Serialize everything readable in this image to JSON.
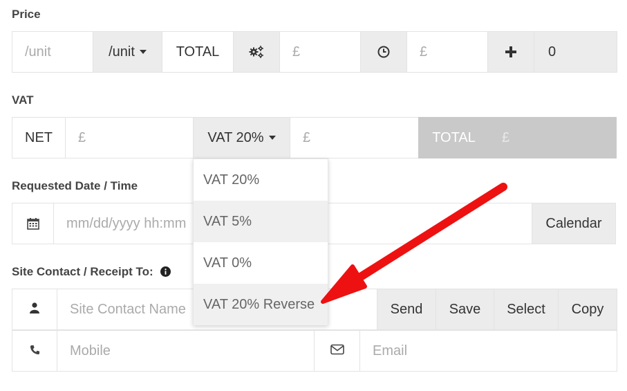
{
  "price": {
    "label": "Price",
    "unit_placeholder": "/unit",
    "unit_dropdown": "/unit",
    "total_label": "TOTAL",
    "total_placeholder": "£",
    "clock_placeholder": "£",
    "quantity_value": "0"
  },
  "vat": {
    "label": "VAT",
    "net_label": "NET",
    "net_placeholder": "£",
    "rate_dropdown": "VAT 20%",
    "vat_placeholder": "£",
    "total_label": "TOTAL",
    "total_placeholder": "£",
    "options": [
      "VAT 20%",
      "VAT 5%",
      "VAT 0%",
      "VAT 20% Reverse"
    ]
  },
  "date": {
    "label": "Requested Date / Time",
    "placeholder": "mm/dd/yyyy hh:mm",
    "calendar_button": "Calendar"
  },
  "site_contact": {
    "label": "Site Contact / Receipt To:",
    "name_placeholder": "Site Contact Name",
    "send_button": "Send",
    "save_button": "Save",
    "select_button": "Select",
    "copy_button": "Copy",
    "mobile_placeholder": "Mobile",
    "email_placeholder": "Email"
  },
  "annotation": {
    "arrow_color": "#ee1111"
  }
}
